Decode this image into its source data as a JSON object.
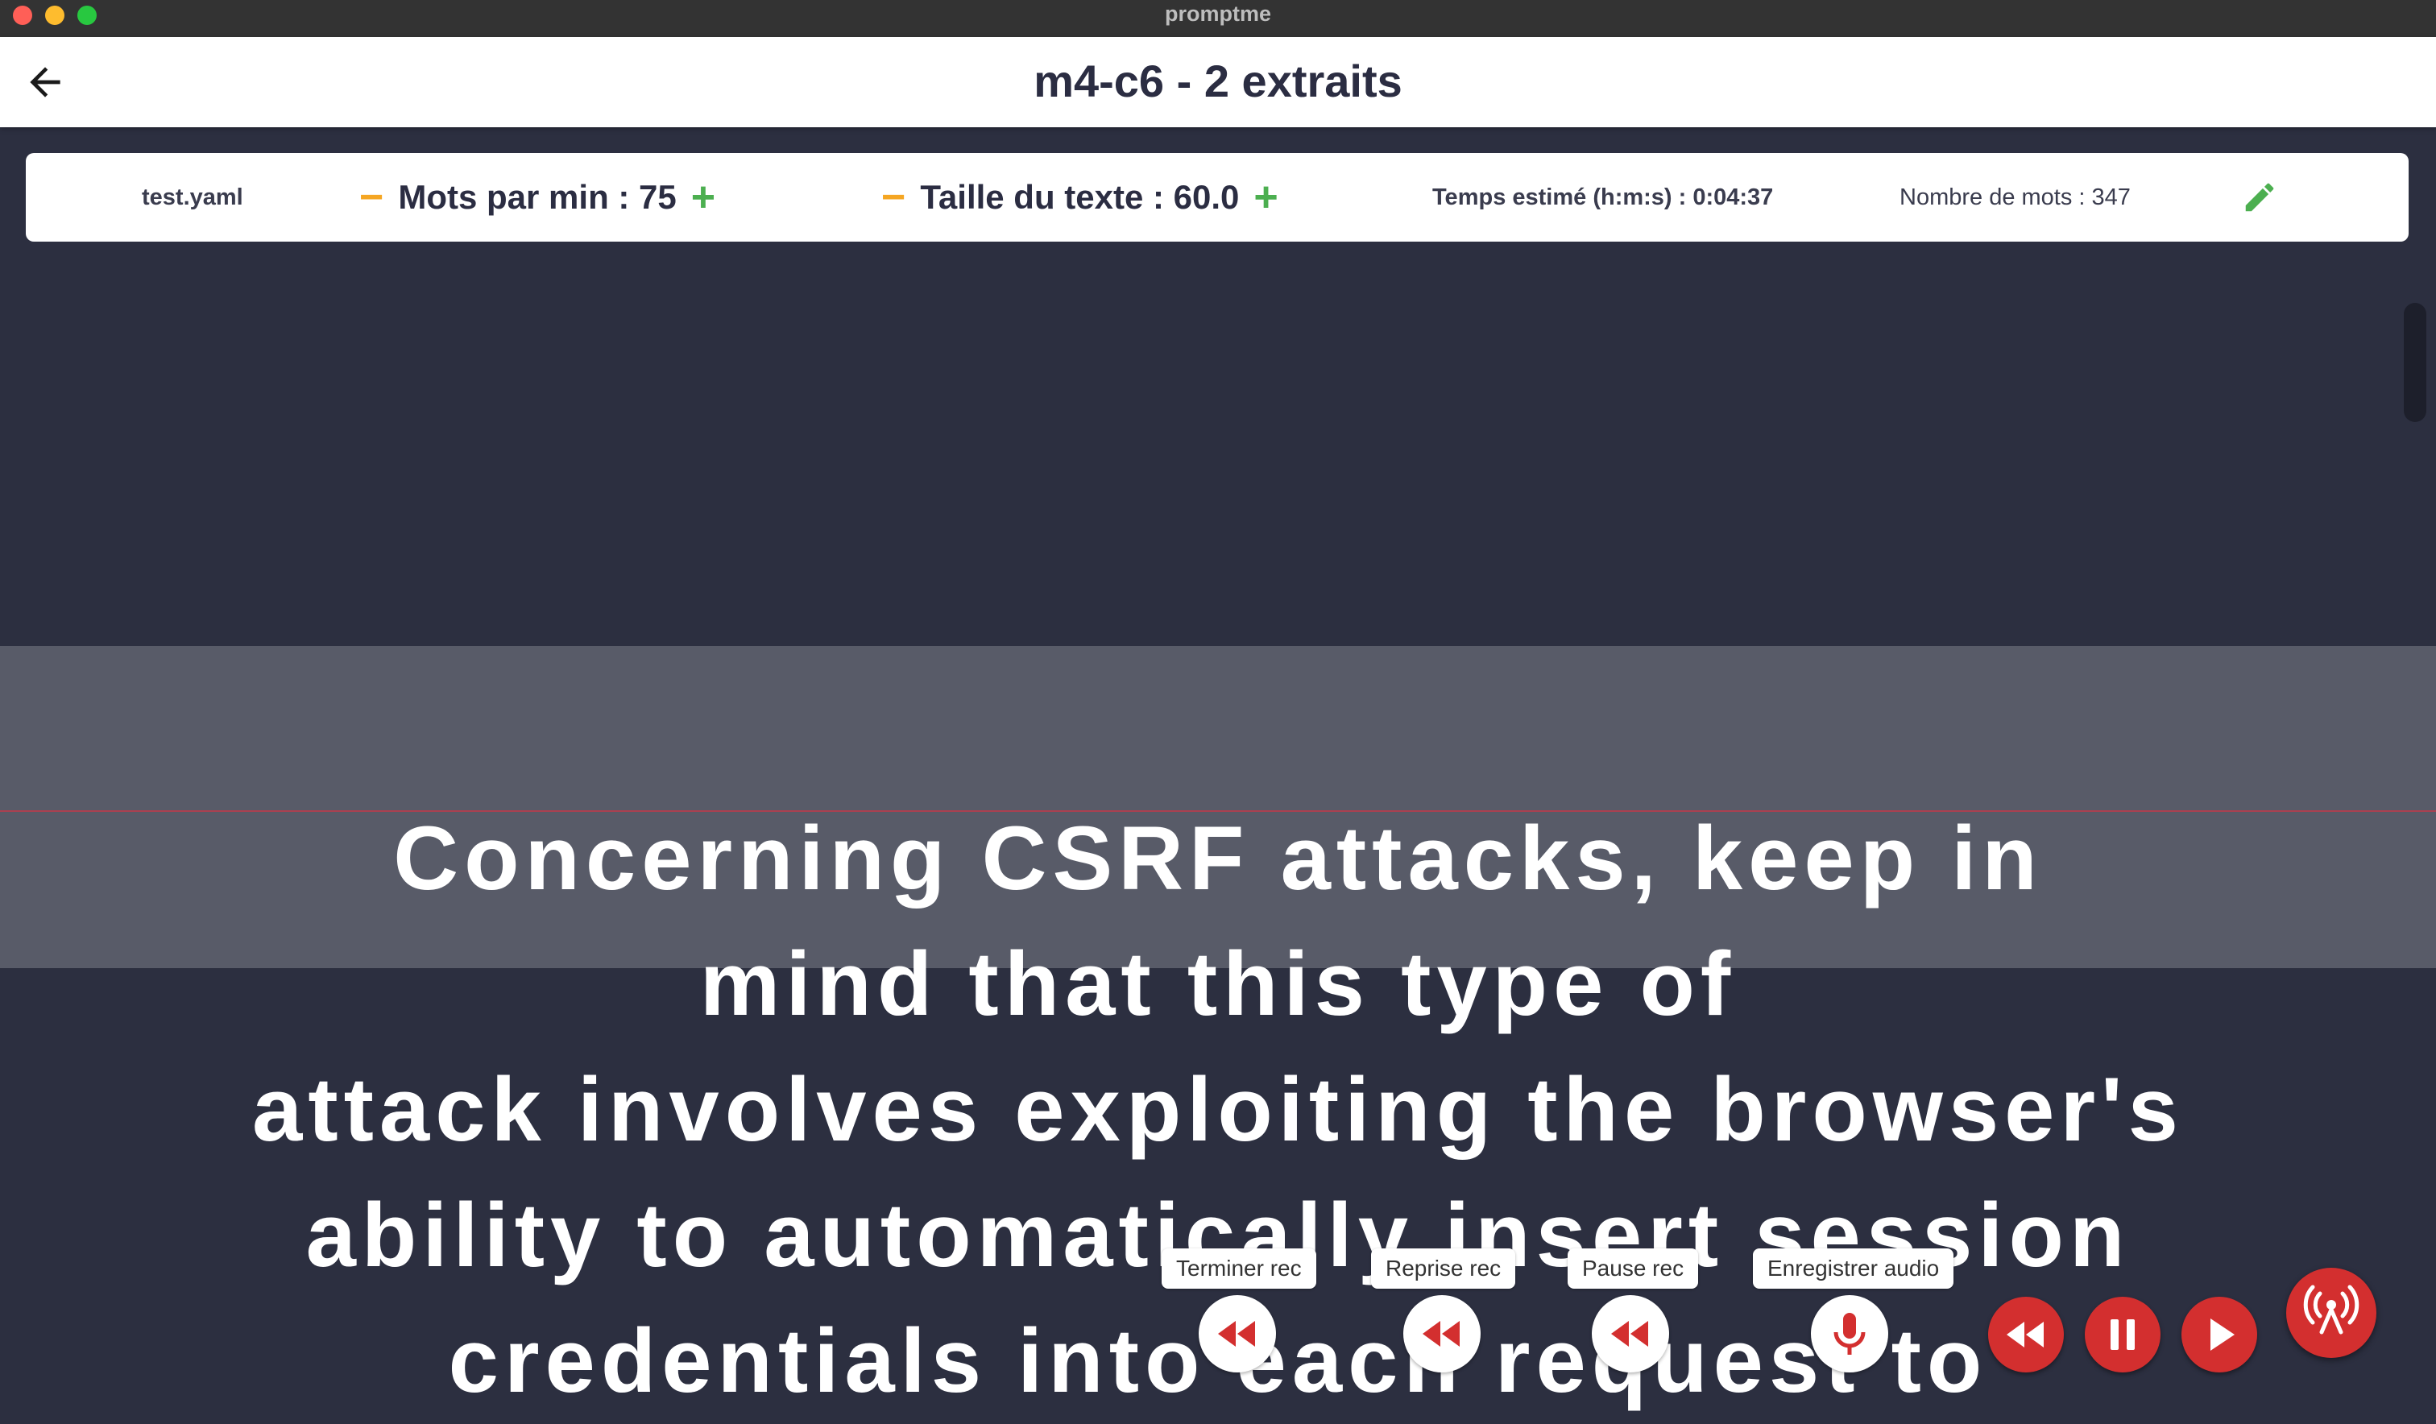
{
  "window": {
    "title": "promptme"
  },
  "header": {
    "title": "m4-c6 - 2 extraits"
  },
  "toolbar": {
    "file_name": "test.yaml",
    "wpm_label": "Mots par min : 75",
    "size_label": "Taille du texte : 60.0",
    "estimated_time": "Temps estimé (h:m:s) : 0:04:37",
    "word_count": "Nombre de mots : 347",
    "minus_symbol": "−",
    "plus_symbol": "+"
  },
  "script": {
    "lines": [
      "Concerning CSRF attacks, keep in",
      "mind that this type of",
      "attack involves exploiting the browser's",
      "ability to automatically insert session",
      "credentials into each request to"
    ]
  },
  "recording": {
    "end_tooltip": "Terminer rec",
    "resume_tooltip": "Reprise rec",
    "pause_tooltip": "Pause rec",
    "record_tooltip": "Enregistrer audio"
  },
  "icons": {
    "back": "arrow-left-icon",
    "edit": "pencil-icon",
    "rewind": "rewind-icon",
    "microphone": "microphone-icon",
    "pause": "pause-icon",
    "play": "play-icon",
    "broadcast": "broadcast-icon"
  },
  "colors": {
    "background": "#2c2f40",
    "reading_band": "#585b68",
    "accent_red": "#d32f2f",
    "minus_orange": "#f5a623",
    "plus_green": "#4caf50",
    "edit_green": "#4caf50"
  }
}
